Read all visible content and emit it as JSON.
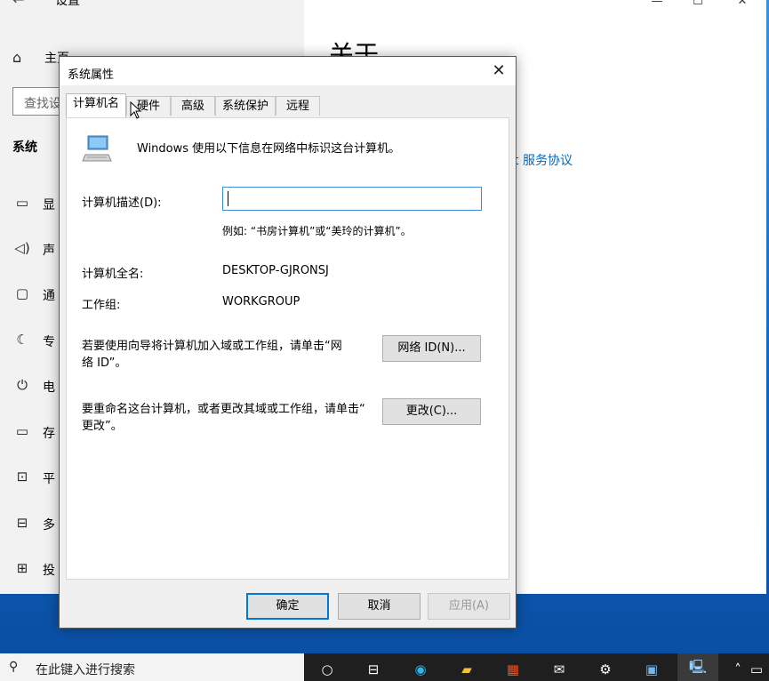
{
  "settings": {
    "title": "设置",
    "home_label": "主页",
    "search_placeholder": "查找设",
    "section_title": "系统",
    "nav_items": [
      {
        "label": "显",
        "icon": "display-icon"
      },
      {
        "label": "声",
        "icon": "sound-icon"
      },
      {
        "label": "通",
        "icon": "notifications-icon"
      },
      {
        "label": "专",
        "icon": "focus-assist-icon"
      },
      {
        "label": "电",
        "icon": "power-icon"
      },
      {
        "label": "存",
        "icon": "storage-icon"
      },
      {
        "label": "平",
        "icon": "tablet-icon"
      },
      {
        "label": "多",
        "icon": "multitasking-icon"
      },
      {
        "label": "投",
        "icon": "projecting-icon"
      }
    ],
    "about_heading": "关于",
    "service_link": "t 服务协议"
  },
  "dialog": {
    "title": "系统属性",
    "tabs": [
      "计算机名",
      "硬件",
      "高级",
      "系统保护",
      "远程"
    ],
    "active_tab": "计算机名",
    "intro": "Windows 使用以下信息在网络中标识这台计算机。",
    "desc_label": "计算机描述(D):",
    "desc_value": "",
    "example": "例如: “书房计算机”或“美玲的计算机”。",
    "fullname_label": "计算机全名:",
    "fullname_value": "DESKTOP-GJRONSJ",
    "workgroup_label": "工作组:",
    "workgroup_value": "WORKGROUP",
    "network_text_line1": "若要使用向导将计算机加入域或工作组，请单击“网",
    "network_text_line2": "络 ID”。",
    "network_button": "网络 ID(N)...",
    "rename_text_line1": "要重命名这台计算机，或者更改其域或工作组，请单击“",
    "rename_text_line2": "更改”。",
    "change_button": "更改(C)...",
    "ok_button": "确定",
    "cancel_button": "取消",
    "apply_button": "应用(A)"
  },
  "taskbar": {
    "search_text": "在此键入进行搜索",
    "icons": [
      "cortana-icon",
      "task-view-icon",
      "edge-icon",
      "file-explorer-icon",
      "store-icon",
      "mail-icon",
      "settings-icon",
      "control-panel-icon",
      "system-properties-icon",
      "tray-chevron-icon",
      "tray-network-icon"
    ]
  },
  "colors": {
    "accent": "#0078d7",
    "link": "#0067c0"
  }
}
